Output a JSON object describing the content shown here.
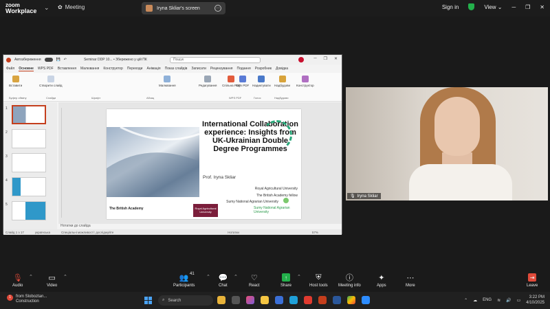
{
  "zoom": {
    "logo_line1": "zoom",
    "logo_line2": "Workplace",
    "meeting_label": "Meeting",
    "share_label": "Iryna Skliar's screen",
    "signin": "Sign in",
    "view": "View",
    "view_chevron": "⌄",
    "minimize": "─",
    "restore": "❐",
    "close": "✕"
  },
  "ppt": {
    "autosave": "Автозбереження",
    "filename": "Seminar DDP 10... • Збережено у цій ПК",
    "search_placeholder": "Пошук",
    "tabs": [
      "Файл",
      "Основне",
      "WPS PDF",
      "Вставлення",
      "Малювання",
      "Конструктор",
      "Переходи",
      "Анімація",
      "Показ слайдів",
      "Записати",
      "Рецензування",
      "Подання",
      "Розробник",
      "Довідка"
    ],
    "ribbon": [
      "Вставити",
      "Створити слайд",
      "Малювання",
      "Редагування",
      "Спільна PDF",
      "Sign PDF",
      "Надиктувати",
      "Надбудови",
      "Конструктор"
    ],
    "group_labels": [
      "Буфер обміну",
      "Слайди",
      "Шрифт",
      "Абзац",
      "WPS PDF",
      "Голос",
      "Надбудови"
    ],
    "slide_numbers": [
      "1",
      "2",
      "3",
      "4",
      "5"
    ],
    "notes": "Нотатки до слайда",
    "status": [
      "Слайд 1 з 17",
      "українська",
      "Спеціальні можливості: досліджуйте",
      "Нотатки",
      "57%"
    ]
  },
  "slide": {
    "title": "International Collaboration experience: Insights from UK-Ukrainian Double Degree Programmes",
    "author": "Prof. Iryna Skliar",
    "affiliations": [
      "Royal Agricultural University",
      "The British Academy fellow",
      "Sumy National Agrarian University"
    ],
    "logo_ba": "The British Academy",
    "logo_rau": "Royal Agricultural University",
    "logo_snau": "Sumy National Agrarian University"
  },
  "participant": {
    "name": "Iryna Skliar"
  },
  "toolbar": {
    "audio": "Audio",
    "video": "Video",
    "participants": "Participants",
    "participants_count": "41",
    "chat": "Chat",
    "react": "React",
    "share": "Share",
    "host_tools": "Host tools",
    "meeting_info": "Meeting info",
    "apps": "Apps",
    "more": "More",
    "leave": "Leave"
  },
  "taskbar": {
    "weather_line1": "from Sloboztan...",
    "weather_line2": "Construction",
    "search": "Search",
    "lang": "ENG",
    "time": "3:22 PM",
    "date": "4/10/2025"
  },
  "colors": {
    "zoom_green": "#23b04b",
    "ppt_red": "#c43e1c",
    "slide_teal": "#2aa87a"
  }
}
